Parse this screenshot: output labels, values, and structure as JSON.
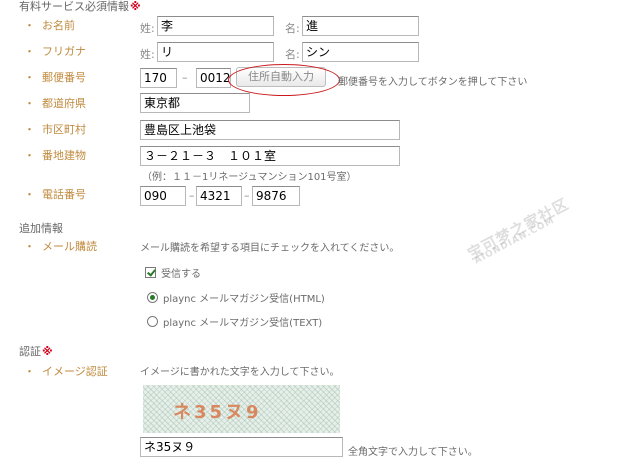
{
  "required_section": {
    "title": "有料サービス必須情報",
    "required_mark": "※",
    "name": {
      "label": "お名前",
      "sei_label": "姓:",
      "sei_value": "李",
      "mei_label": "名:",
      "mei_value": "進"
    },
    "furigana": {
      "label": "フリガナ",
      "sei_label": "姓:",
      "sei_value": "リ",
      "mei_label": "名:",
      "mei_value": "シン"
    },
    "postal": {
      "label": "郵便番号",
      "part1": "170",
      "dash": "–",
      "part2": "0012",
      "button": "住所自動入力",
      "hint": "郵便番号を入力してボタンを押して下さい"
    },
    "prefecture": {
      "label": "都道府県",
      "value": "東京都"
    },
    "city": {
      "label": "市区町村",
      "value": "豊島区上池袋"
    },
    "address": {
      "label": "番地建物",
      "value": "３－２１－３　１０１室",
      "example": "（例：１１－1リネージュマンション101号室）"
    },
    "phone": {
      "label": "電話番号",
      "part1": "090",
      "dash": "–",
      "part2": "4321",
      "part3": "9876"
    }
  },
  "additional_section": {
    "title": "追加情報",
    "newsletter": {
      "label": "メール購読",
      "description": "メール購読を希望する項目にチェックを入れてください。",
      "checkbox_label": "受信する",
      "radio_html": "plaync メールマガジン受信(HTML)",
      "radio_text": "plaync メールマガジン受信(TEXT)"
    }
  },
  "auth_section": {
    "title": "認証",
    "required_mark": "※",
    "image_auth": {
      "label": "イメージ認証",
      "description": "イメージに書かれた文字を入力して下さい。",
      "captcha_text": "ネ35ヌ9",
      "input_value": "ネ35ヌ９",
      "hint": "全角文字で入力して下さい。"
    }
  },
  "watermark": {
    "main": "宝可梦之家社区",
    "sub": "AIONDIAN.COM"
  },
  "colors": {
    "label": "#c08a3e",
    "required": "#d0021b",
    "highlight_circle": "#c9191e"
  }
}
